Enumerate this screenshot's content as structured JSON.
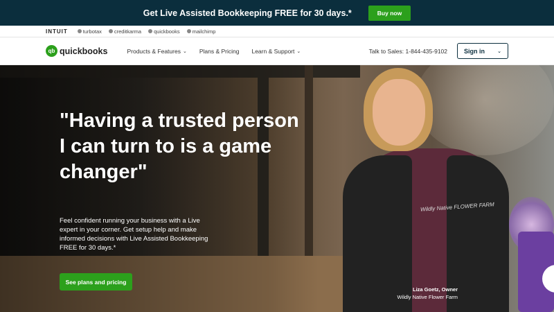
{
  "promo": {
    "text": "Get Live Assisted Bookkeeping FREE for 30 days.*",
    "button": "Buy now"
  },
  "brandbar": {
    "intuit": "INTUIT",
    "brands": [
      "turbotax",
      "creditkarma",
      "quickbooks",
      "mailchimp"
    ]
  },
  "nav": {
    "logo_mark": "qb",
    "logo_text": "quickbooks",
    "items": [
      {
        "label": "Products & Features",
        "chevron": true
      },
      {
        "label": "Plans & Pricing",
        "chevron": false
      },
      {
        "label": "Learn & Support",
        "chevron": true
      }
    ],
    "phone": "Talk to Sales: 1-844-435-9102",
    "signin": "Sign in"
  },
  "hero": {
    "headline": "\"Having a trusted person I can turn to is a game changer\"",
    "sub": "Feel confident running your business with a Live expert in your corner. Get setup help and make informed decisions with Live Assisted Bookkeeping FREE for 30 days.*",
    "cta": "See plans and pricing",
    "caption_name": "Liza Goetz, Owner",
    "caption_company": "Wildly Native Flower Farm",
    "vest_logo": "Wildly Native FLOWER FARM"
  },
  "colors": {
    "promo_bg": "#0b2e3d",
    "accent_green": "#2ca01c"
  }
}
